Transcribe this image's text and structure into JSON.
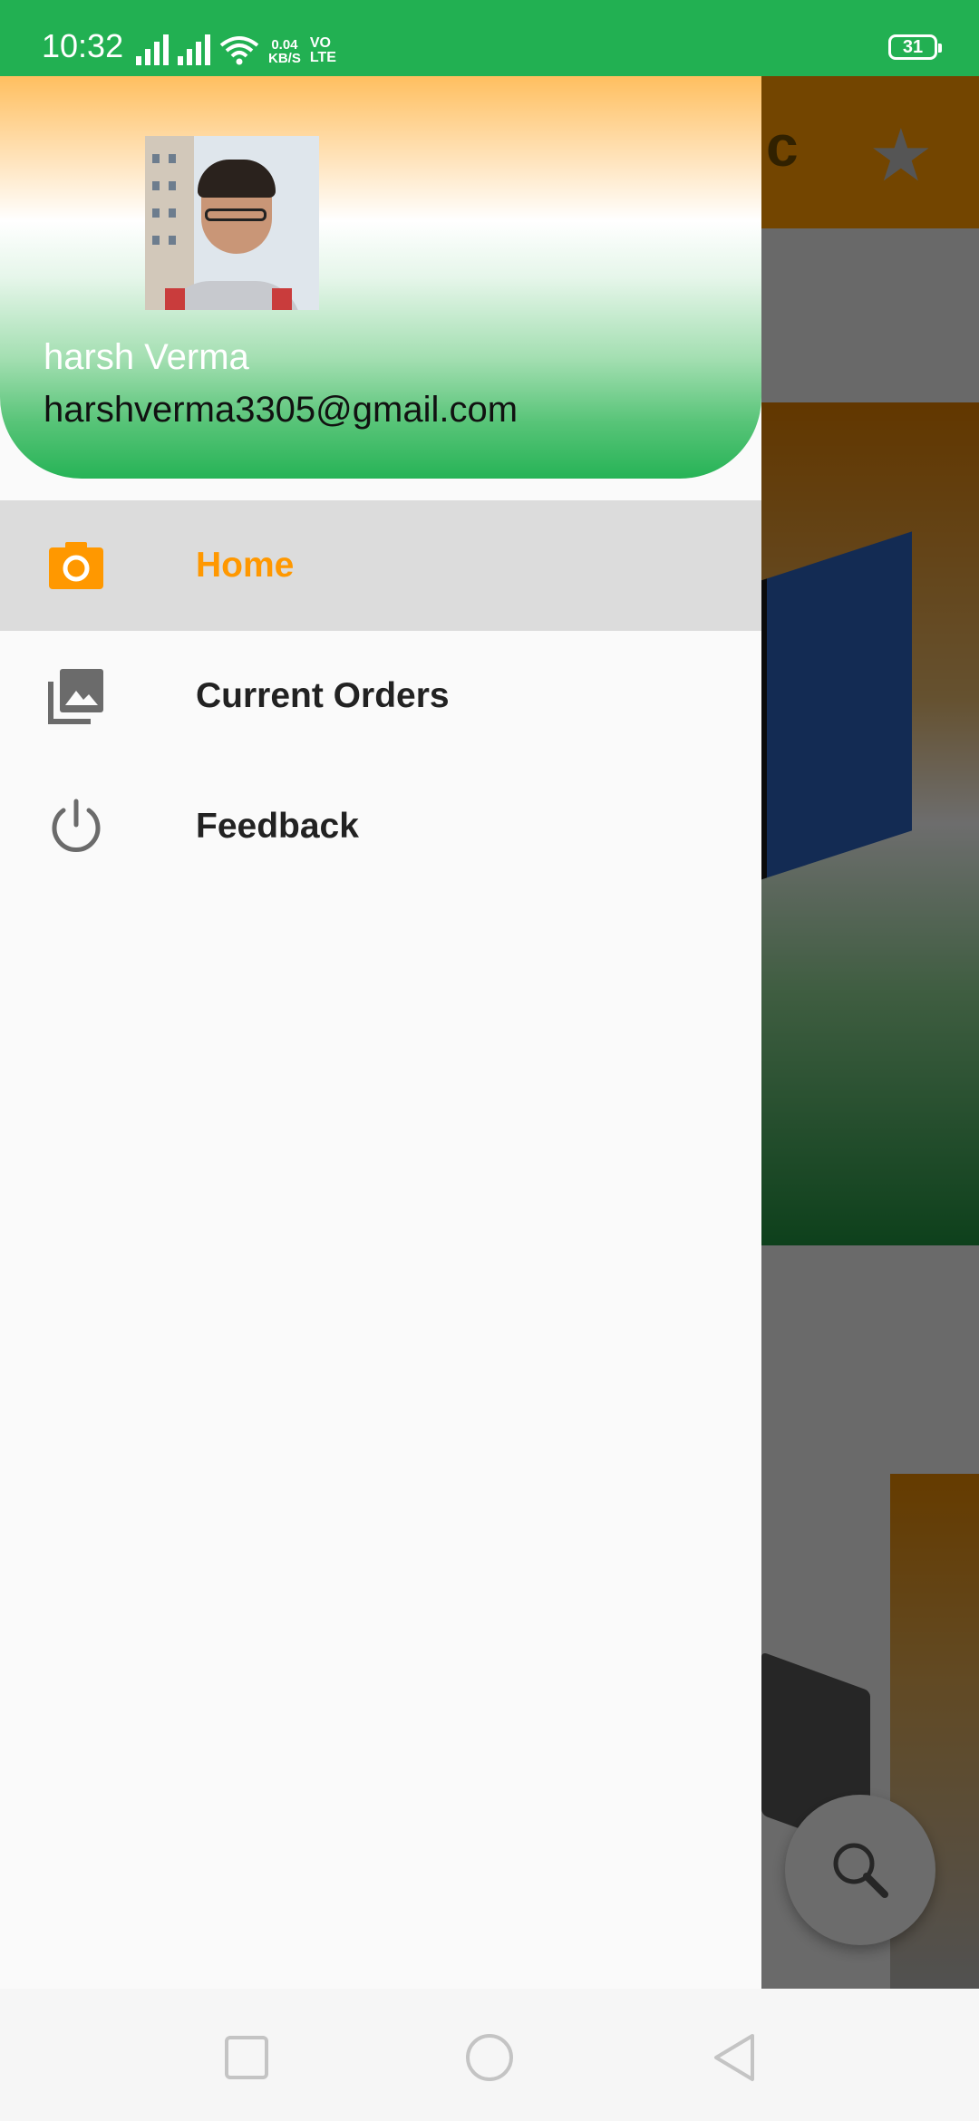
{
  "status_bar": {
    "time": "10:32",
    "data_speed_value": "0.04",
    "data_speed_unit": "KB/S",
    "network_label_top": "VO",
    "network_label_bottom": "LTE",
    "battery": "31"
  },
  "drawer": {
    "user": {
      "name": "harsh Verma",
      "email": "harshverma3305@gmail.com"
    },
    "items": [
      {
        "label": "Home",
        "icon": "camera-icon",
        "active": true
      },
      {
        "label": "Current Orders",
        "icon": "photo-library-icon",
        "active": false
      },
      {
        "label": "Feedback",
        "icon": "power-icon",
        "active": false
      }
    ]
  },
  "colors": {
    "status_bar": "#22b052",
    "accent": "#ff9800",
    "header_top": "#ffbf5f",
    "header_bottom": "#26b356"
  },
  "nav_bar": {
    "buttons": [
      "recent-apps",
      "home",
      "back"
    ]
  }
}
